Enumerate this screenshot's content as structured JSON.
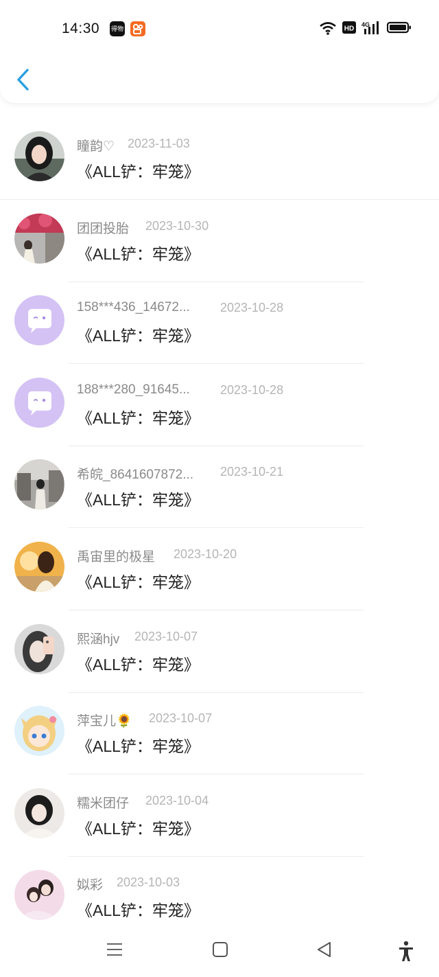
{
  "status": {
    "time": "14:30",
    "app_icon_1": "得物",
    "app_icon_2": "kuaishou-icon"
  },
  "header": {
    "back": "chevron-left-icon"
  },
  "items": [
    {
      "name": "瞳韵♡",
      "date": "2023-11-03",
      "title": "《ALL铲：牢笼》",
      "avatar": "photo-girl-1"
    },
    {
      "name": "团团投胎",
      "date": "2023-10-30",
      "title": "《ALL铲：牢笼》",
      "avatar": "photo-flowers"
    },
    {
      "name": "158***436_14672...",
      "date": "2023-10-28",
      "title": "《ALL铲：牢笼》",
      "avatar": "default-chat-avatar"
    },
    {
      "name": "188***280_91645...",
      "date": "2023-10-28",
      "title": "《ALL铲：牢笼》",
      "avatar": "default-chat-avatar"
    },
    {
      "name": "希皖_8641607872...",
      "date": "2023-10-21",
      "title": "《ALL铲：牢笼》",
      "avatar": "photo-street"
    },
    {
      "name": "禹宙里的极星",
      "date": "2023-10-20",
      "title": "《ALL铲：牢笼》",
      "avatar": "photo-sunset"
    },
    {
      "name": "熙涵hjv",
      "date": "2023-10-07",
      "title": "《ALL铲：牢笼》",
      "avatar": "photo-selfie"
    },
    {
      "name": "萍宝儿🌻",
      "date": "2023-10-07",
      "title": "《ALL铲：牢笼》",
      "avatar": "anime-girl"
    },
    {
      "name": "糯米团仔",
      "date": "2023-10-04",
      "title": "《ALL铲：牢笼》",
      "avatar": "photo-girl-2"
    },
    {
      "name": "姒彩",
      "date": "2023-10-03",
      "title": "《ALL铲：牢笼》",
      "avatar": "photo-couple"
    }
  ],
  "navbar": [
    "menu-icon",
    "home-square-icon",
    "back-triangle-icon",
    "accessibility-icon"
  ]
}
